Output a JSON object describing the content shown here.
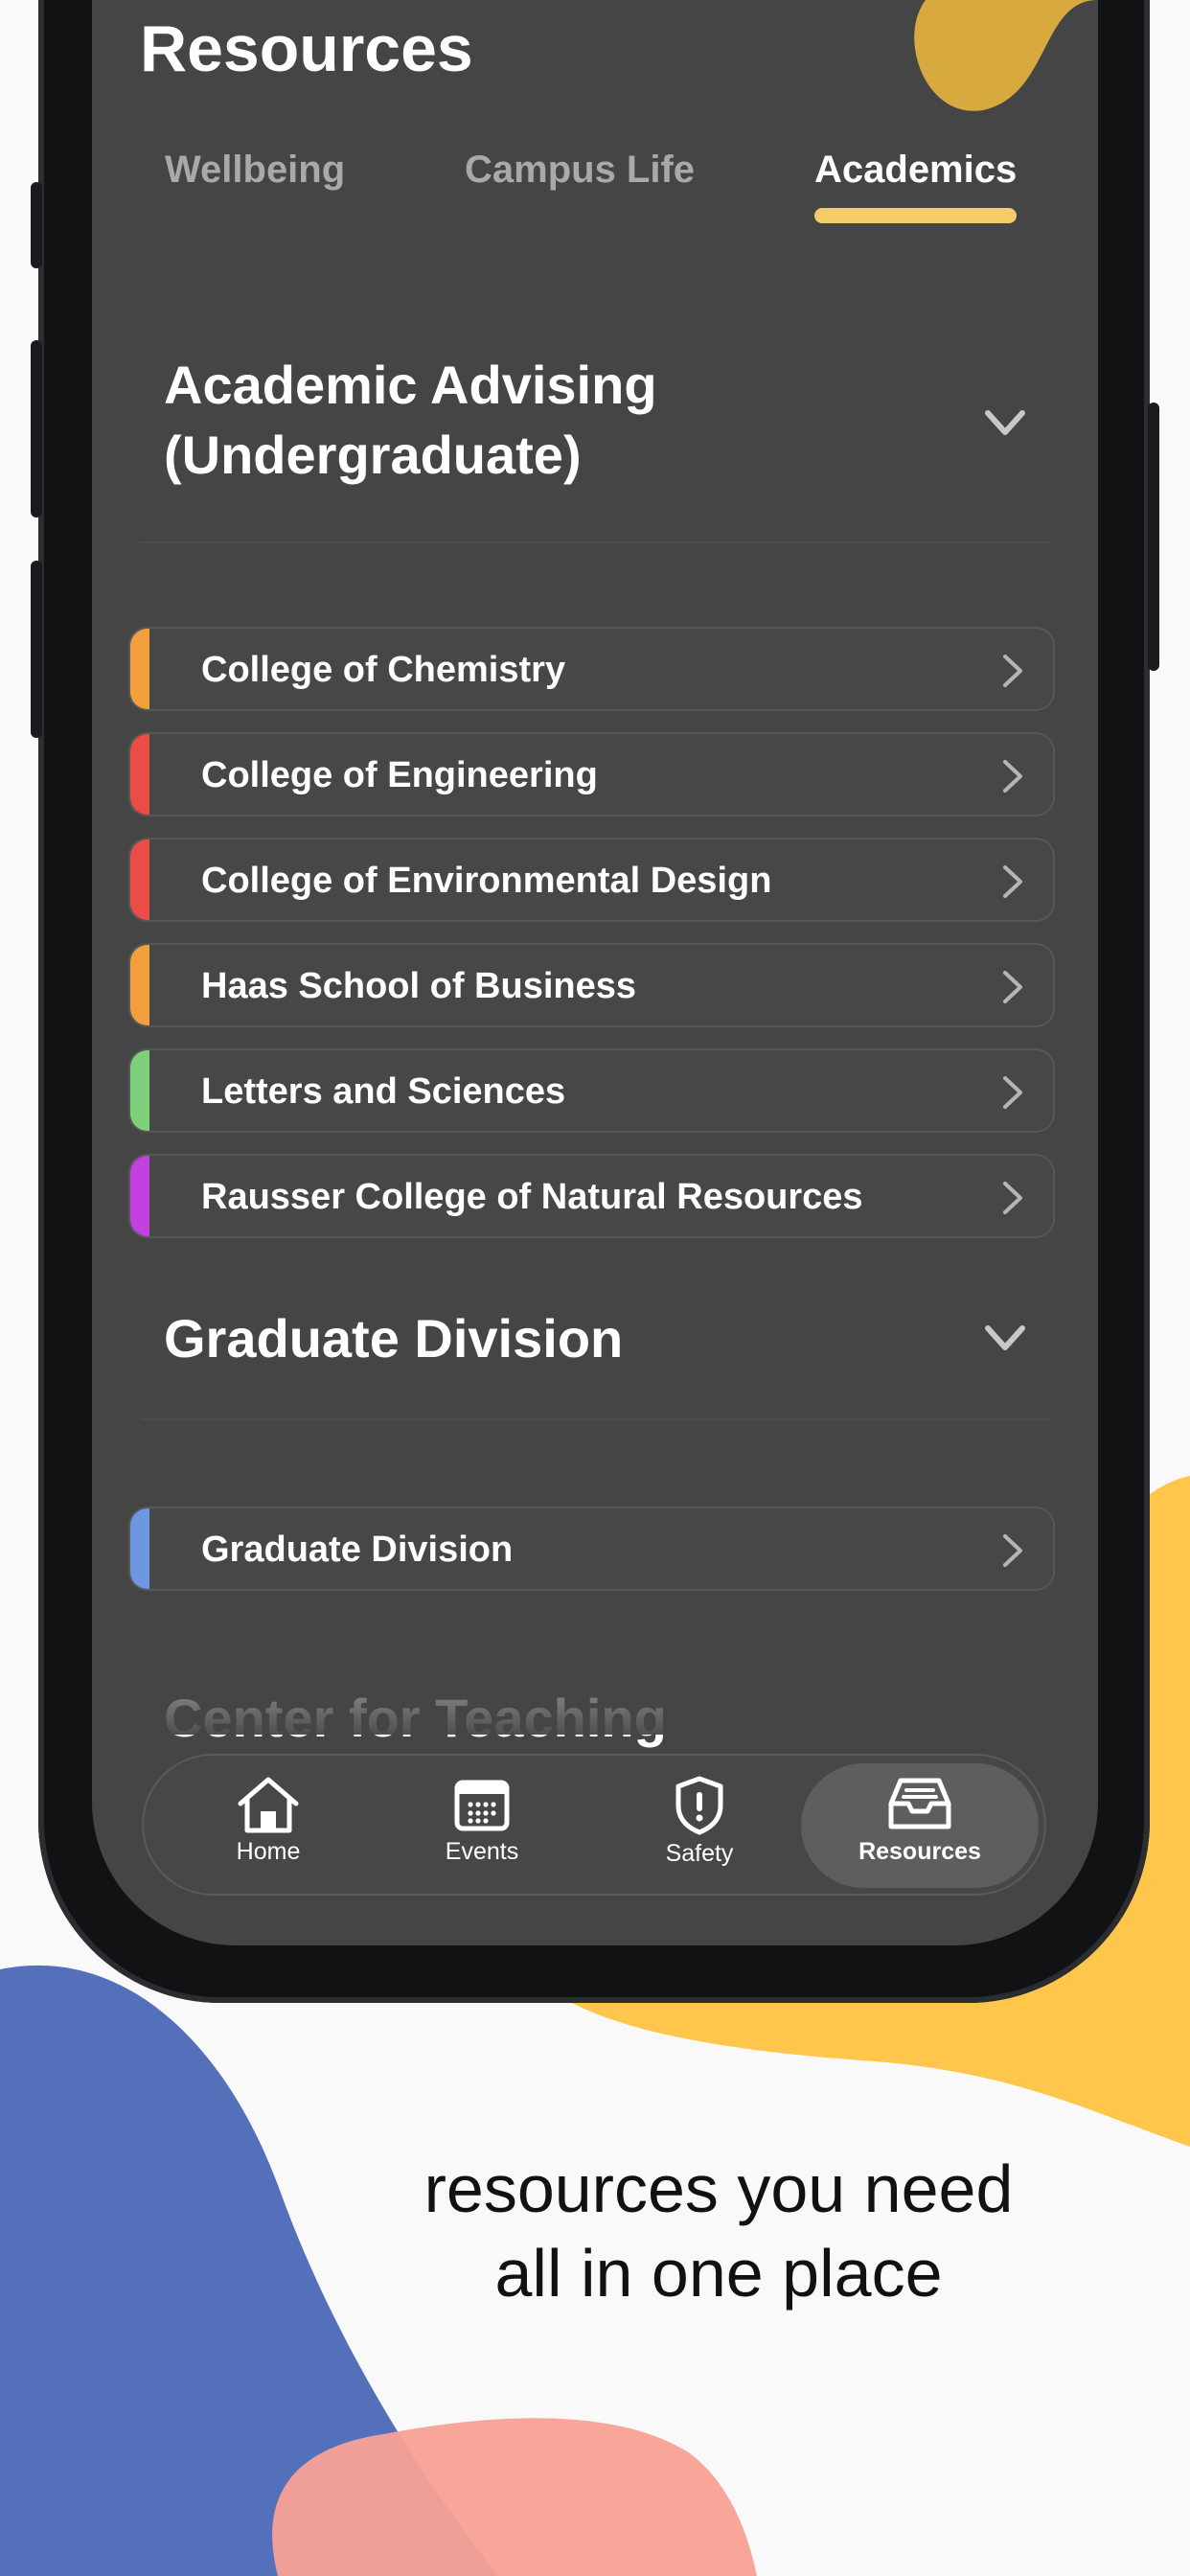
{
  "screen": {
    "title": "Resources",
    "tabs": [
      {
        "label": "Wellbeing",
        "active": false
      },
      {
        "label": "Campus Life",
        "active": false
      },
      {
        "label": "Academics",
        "active": true
      }
    ]
  },
  "sections": [
    {
      "title": "Academic Advising (Undergraduate)",
      "icon": "chevron-down-icon",
      "items": [
        {
          "label": "College of Chemistry",
          "accent": "#f2a03d"
        },
        {
          "label": "College of Engineering",
          "accent": "#ea4d45"
        },
        {
          "label": "College of Environmental Design",
          "accent": "#ea4d45"
        },
        {
          "label": "Haas School of Business",
          "accent": "#f2a03d"
        },
        {
          "label": "Letters and Sciences",
          "accent": "#7fd07a"
        },
        {
          "label": "Rausser College of Natural Resources",
          "accent": "#c23fe0"
        }
      ]
    },
    {
      "title": "Graduate Division",
      "icon": "chevron-down-icon",
      "items": [
        {
          "label": "Graduate Division",
          "accent": "#6f96e0"
        }
      ]
    },
    {
      "title": "Center for Teaching"
    }
  ],
  "nav": [
    {
      "label": "Home",
      "icon": "home-icon",
      "active": false
    },
    {
      "label": "Events",
      "icon": "calendar-icon",
      "active": false
    },
    {
      "label": "Safety",
      "icon": "shield-alert-icon",
      "active": false
    },
    {
      "label": "Resources",
      "icon": "inbox-tray-icon",
      "active": true
    }
  ],
  "tagline": {
    "line1": "resources you need",
    "line2": "all in one place"
  },
  "colors": {
    "accent_yellow": "#f5cc6a",
    "blob_yellow": "#fec64a",
    "blob_blue": "#5470bb",
    "blob_pink": "#f8a195",
    "screen_bg": "#454545"
  }
}
